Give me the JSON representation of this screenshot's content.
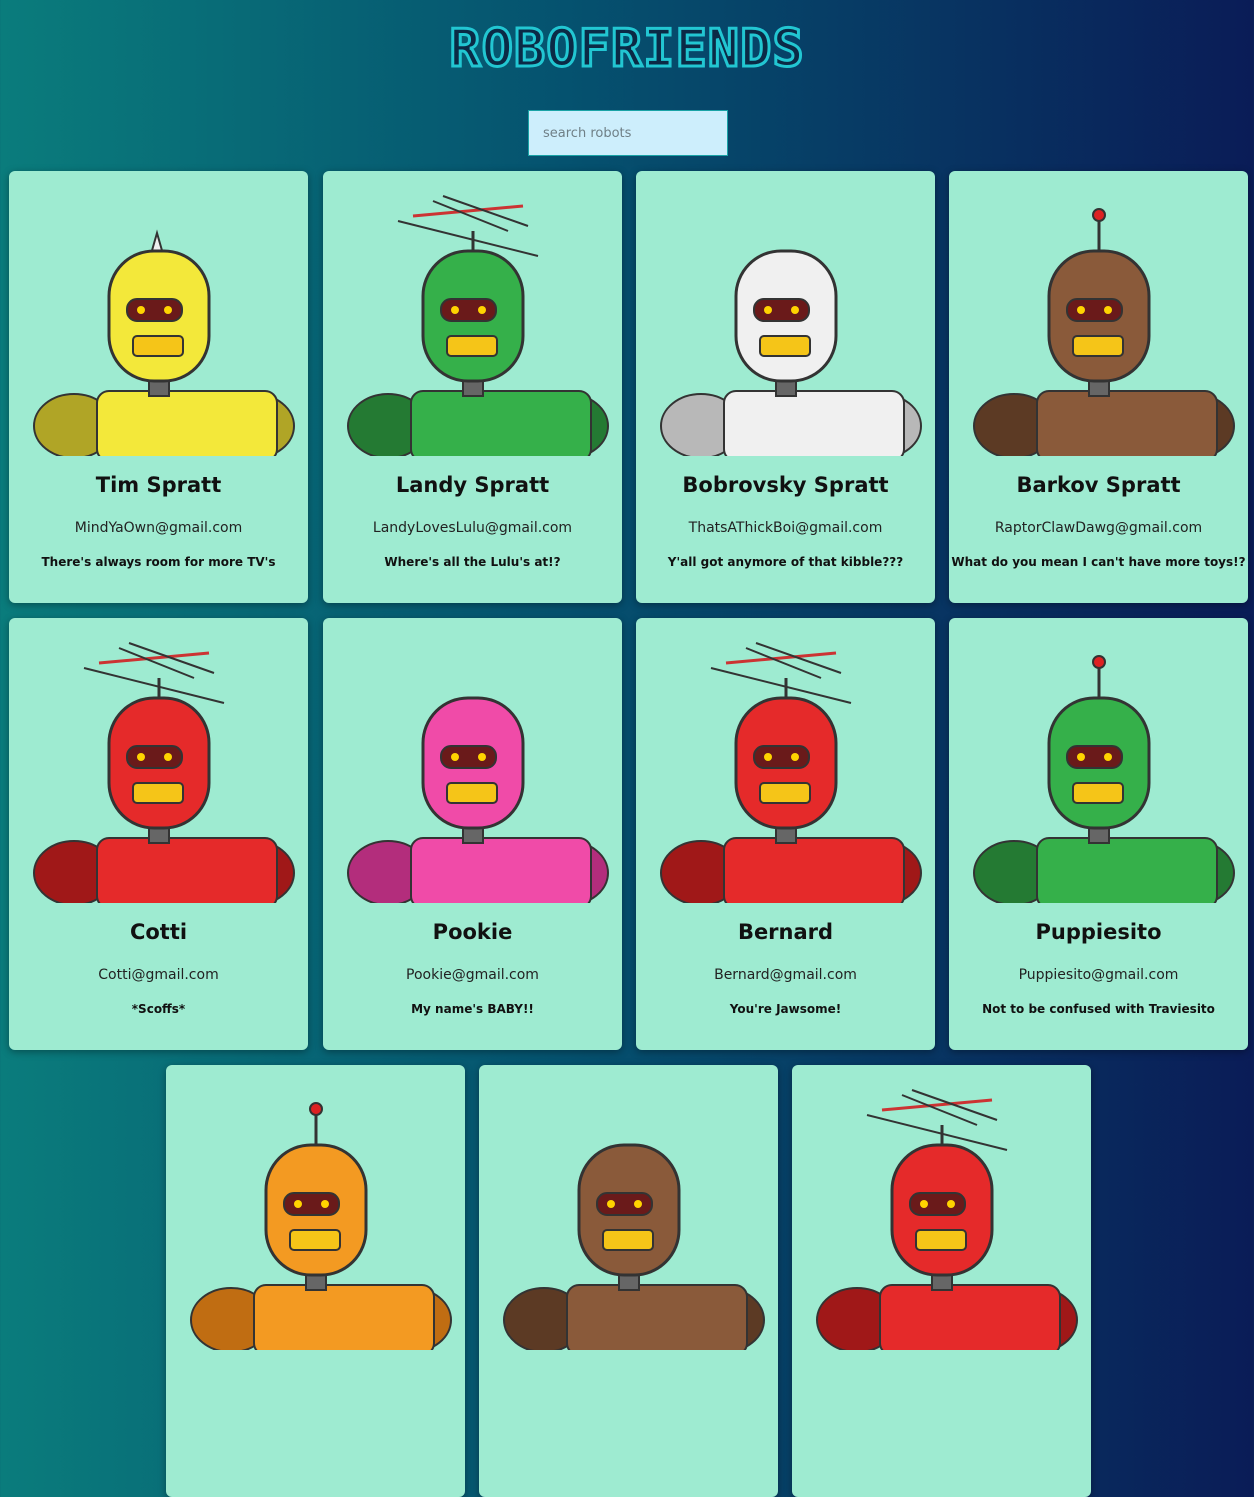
{
  "header": {
    "title": "ROBOFRIENDS"
  },
  "search": {
    "placeholder": "search robots",
    "value": ""
  },
  "cards": [
    {
      "name": "Tim Spratt",
      "email": "MindYaOwn@gmail.com",
      "quote": "There's always room for more TV's",
      "color": "#f3e83a",
      "shade": "#b0a526"
    },
    {
      "name": "Landy Spratt",
      "email": "LandyLovesLulu@gmail.com",
      "quote": "Where's all the Lulu's at!?",
      "color": "#35b04a",
      "shade": "#247a33"
    },
    {
      "name": "Bobrovsky Spratt",
      "email": "ThatsAThickBoi@gmail.com",
      "quote": "Y'all got anymore of that kibble???",
      "color": "#f0f0f0",
      "shade": "#b8b8b8"
    },
    {
      "name": "Barkov Spratt",
      "email": "RaptorClawDawg@gmail.com",
      "quote": "What do you mean I can't have more toys!?",
      "color": "#8a5a3a",
      "shade": "#5c3a24"
    },
    {
      "name": "Cotti",
      "email": "Cotti@gmail.com",
      "quote": "*Scoffs*",
      "color": "#e52a2a",
      "shade": "#a01818"
    },
    {
      "name": "Pookie",
      "email": "Pookie@gmail.com",
      "quote": "My name's BABY!!",
      "color": "#f04ba8",
      "shade": "#b32d7c"
    },
    {
      "name": "Bernard",
      "email": "Bernard@gmail.com",
      "quote": "You're Jawsome!",
      "color": "#e52a2a",
      "shade": "#a01818"
    },
    {
      "name": "Puppiesito",
      "email": "Puppiesito@gmail.com",
      "quote": "Not to be confused with Traviesito",
      "color": "#35b04a",
      "shade": "#247a33"
    },
    {
      "name": "",
      "email": "",
      "quote": "",
      "color": "#f39a22",
      "shade": "#c06d12"
    },
    {
      "name": "",
      "email": "",
      "quote": "",
      "color": "#8a5a3a",
      "shade": "#5c3a24"
    },
    {
      "name": "",
      "email": "",
      "quote": "",
      "color": "#e52a2a",
      "shade": "#a01818"
    }
  ]
}
